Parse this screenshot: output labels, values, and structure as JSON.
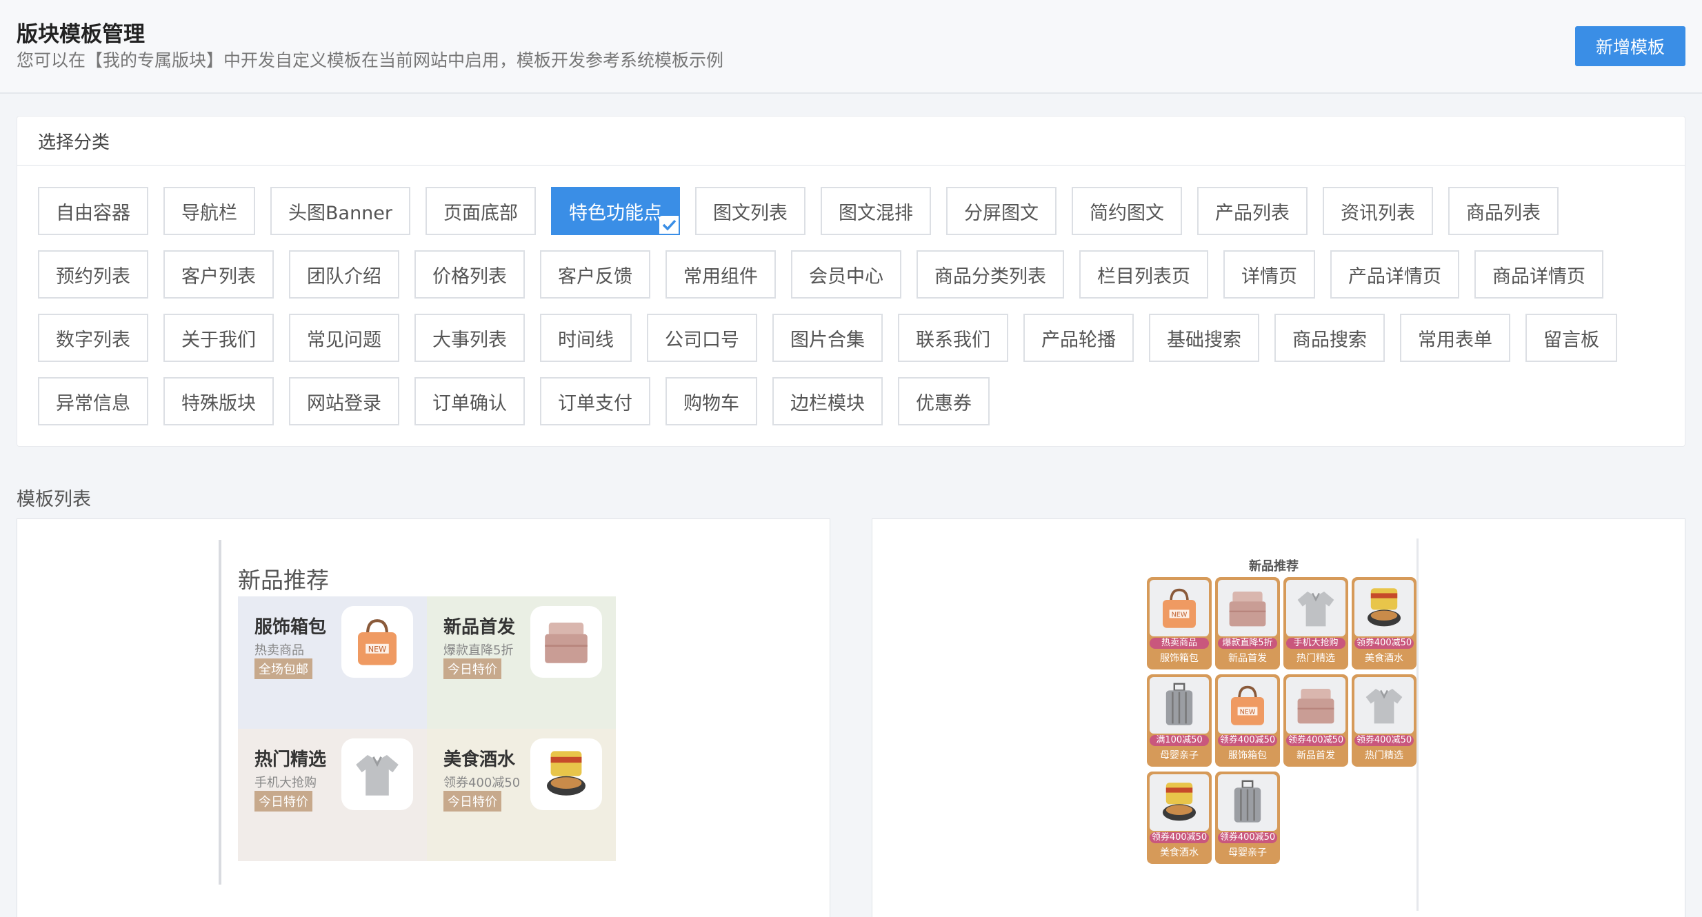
{
  "header": {
    "title": "版块模板管理",
    "description": "您可以在【我的专属版块】中开发自定义模板在当前网站中启用，模板开发参考系统模板示例",
    "add_button": "新增模板"
  },
  "categories": {
    "heading": "选择分类",
    "selected": "特色功能点",
    "items": [
      "自由容器",
      "导航栏",
      "头图Banner",
      "页面底部",
      "特色功能点",
      "图文列表",
      "图文混排",
      "分屏图文",
      "简约图文",
      "产品列表",
      "资讯列表",
      "商品列表",
      "预约列表",
      "客户列表",
      "团队介绍",
      "价格列表",
      "客户反馈",
      "常用组件",
      "会员中心",
      "商品分类列表",
      "栏目列表页",
      "详情页",
      "产品详情页",
      "商品详情页",
      "数字列表",
      "关于我们",
      "常见问题",
      "大事列表",
      "时间线",
      "公司口号",
      "图片合集",
      "联系我们",
      "产品轮播",
      "基础搜索",
      "商品搜索",
      "常用表单",
      "留言板",
      "异常信息",
      "特殊版块",
      "网站登录",
      "订单确认",
      "订单支付",
      "购物车",
      "边栏模块",
      "优惠券"
    ]
  },
  "templates": {
    "heading": "模板列表",
    "preview1": {
      "title": "新品推荐",
      "tiles": [
        {
          "name": "服饰箱包",
          "sub": "热卖商品",
          "tag": "全场包邮",
          "icon": "bag-icon",
          "bg": "#e8ebf3"
        },
        {
          "name": "新品首发",
          "sub": "爆款直降5折",
          "tag": "今日特价",
          "icon": "bedding-icon",
          "bg": "#eaefe4"
        },
        {
          "name": "热门精选",
          "sub": "手机大抢购",
          "tag": "今日特价",
          "icon": "shirt-icon",
          "bg": "#f1ece9"
        },
        {
          "name": "美食酒水",
          "sub": "领券400减50",
          "tag": "今日特价",
          "icon": "noodle-bowl-icon",
          "bg": "#f1eee2"
        }
      ]
    },
    "preview2": {
      "title": "新品推荐",
      "items": [
        {
          "badge": "热卖商品",
          "name": "服饰箱包",
          "icon": "bag-icon"
        },
        {
          "badge": "爆款直降5折",
          "name": "新品首发",
          "icon": "bedding-icon"
        },
        {
          "badge": "手机大抢购",
          "name": "热门精选",
          "icon": "shirt-icon"
        },
        {
          "badge": "领券400减50",
          "name": "美食酒水",
          "icon": "noodle-bowl-icon"
        },
        {
          "badge": "满100减50",
          "name": "母婴亲子",
          "icon": "suitcase-icon"
        },
        {
          "badge": "领券400减50",
          "name": "服饰箱包",
          "icon": "bag-icon"
        },
        {
          "badge": "领券400减50",
          "name": "新品首发",
          "icon": "bedding-icon"
        },
        {
          "badge": "领券400减50",
          "name": "热门精选",
          "icon": "shirt-icon"
        },
        {
          "badge": "领券400减50",
          "name": "美食酒水",
          "icon": "noodle-bowl-icon"
        },
        {
          "badge": "领券400减50",
          "name": "母婴亲子",
          "icon": "suitcase-icon"
        }
      ]
    }
  },
  "colors": {
    "accent": "#3a8ee6",
    "tag": "#c7a98c",
    "mini_frame": "#d69a59",
    "mini_badge": "#c9577d"
  }
}
